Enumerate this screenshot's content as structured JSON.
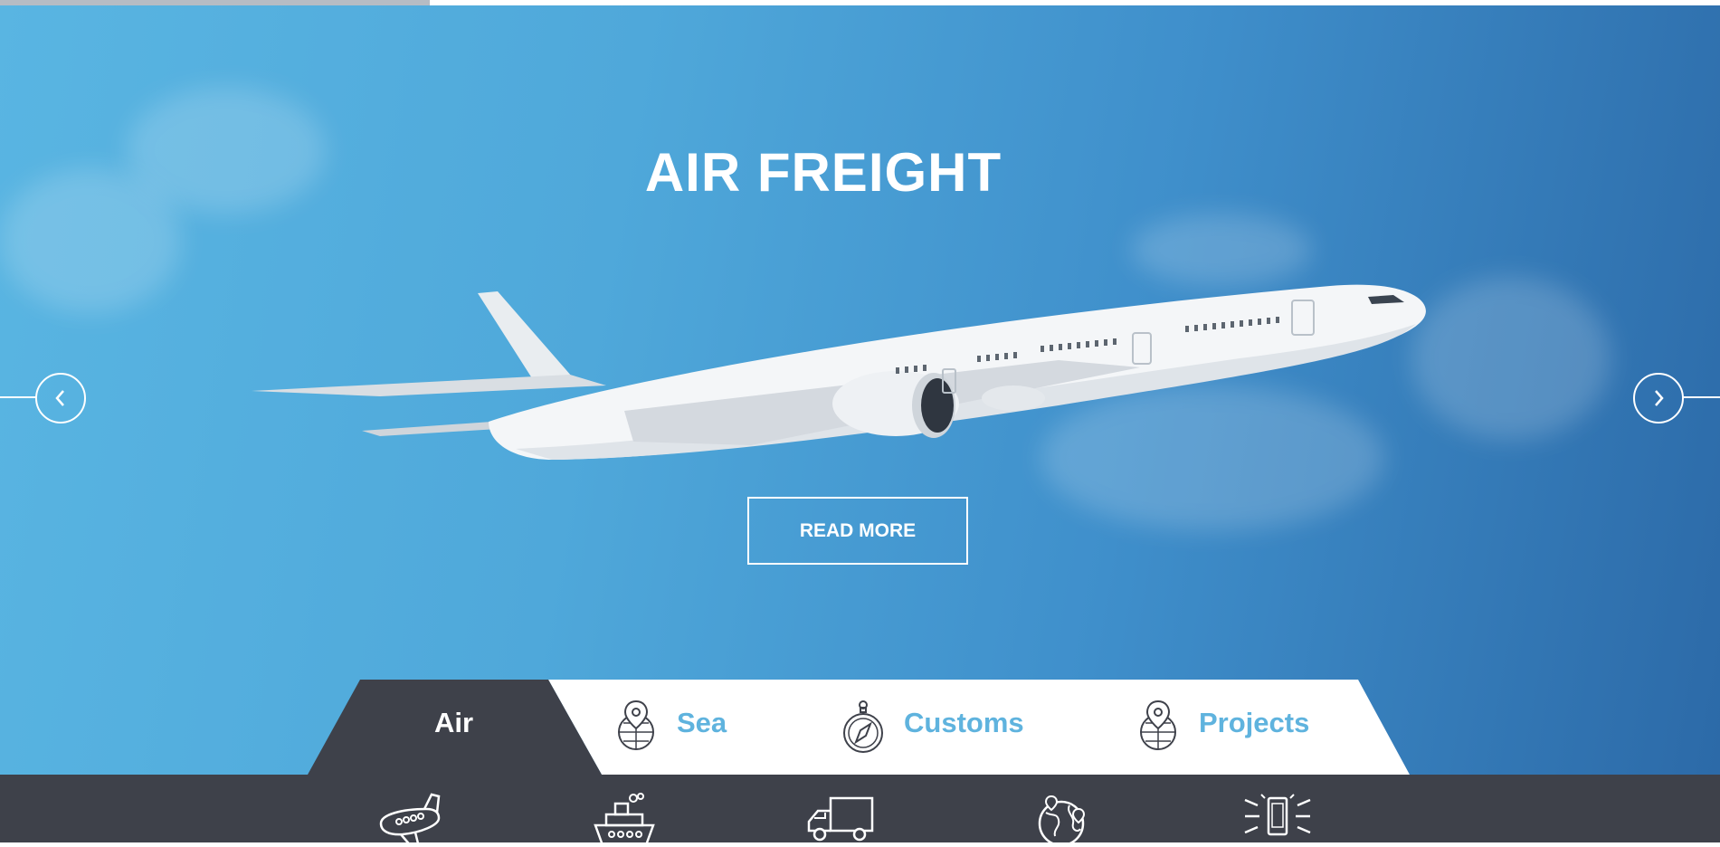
{
  "slider": {
    "title": "AIR FREIGHT",
    "read_more_label": "READ MORE",
    "progress_fraction": 0.25,
    "prev_icon": "chevron-left-icon",
    "next_icon": "chevron-right-icon"
  },
  "tabs": [
    {
      "label": "Air",
      "active": true
    },
    {
      "label": "Sea",
      "icon": "globe-pin-icon",
      "active": false
    },
    {
      "label": "Customs",
      "icon": "compass-icon",
      "active": false
    },
    {
      "label": "Projects",
      "icon": "globe-pin-icon",
      "active": false
    }
  ],
  "service_icons": [
    "airplane-icon",
    "ship-icon",
    "truck-icon",
    "world-map-icon",
    "mobile-device-icon"
  ],
  "colors": {
    "accent": "#5fb3de",
    "dark": "#3e414a",
    "white": "#ffffff"
  }
}
